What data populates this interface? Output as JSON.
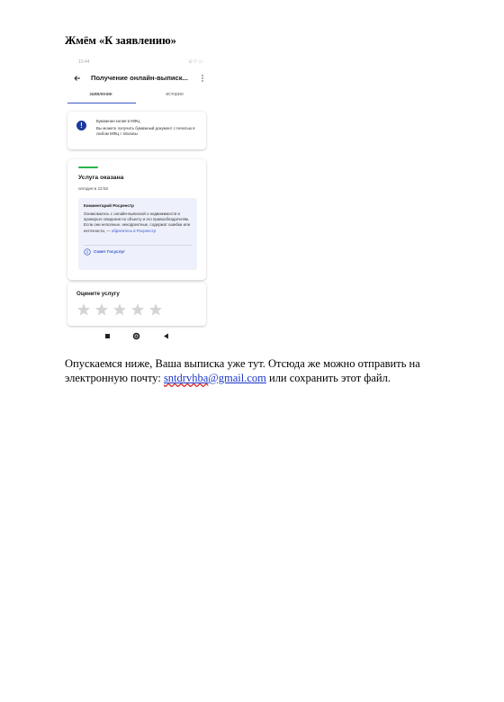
{
  "heading": "Жмём «К заявлению»",
  "phone": {
    "status_time": "10:44",
    "status_icons": "⊙ ▽ ▭",
    "appbar_title": "Получение онлайн-выписк...",
    "tabs": [
      {
        "label": "заявление",
        "active": true
      },
      {
        "label": "история",
        "active": false
      }
    ],
    "info_card": {
      "title": "Бумажная копия в МФЦ",
      "text": "Вы можете получить бумажный документ с печатью в любом МФЦ г. Москвы"
    },
    "service_card": {
      "title": "Услуга оказана",
      "time": "сегодня в 12:52",
      "comment_title": "Комментарий Росреестр",
      "comment_text": "Ознакомьтесь с онлайн-выпиской о недвижимости и проверьте сведения по объекту и его правообладателям. Если они неполные, некорректные, содержат ошибки или неточности, —",
      "comment_link": "обратитесь в Росреестр",
      "advice_label": "Совет Госуслуг"
    },
    "rating_card": {
      "title": "Оцените услугу",
      "stars_total": 5,
      "stars_filled": 0
    },
    "colors": {
      "accent": "#3a57c7",
      "info_icon": "#1d3a9e",
      "success": "#2bb34a",
      "comment_bg": "#eef1fb",
      "star_empty": "#d4d4d4"
    }
  },
  "paragraph": {
    "before": "Опускаемся ниже, Ваша выписка уже тут. Отсюда же можно отправить на электронную почту: ",
    "email_flagged": "sntdrvhba",
    "email_rest": "@gmail.com",
    "after": " или сохранить этот файл."
  },
  "icons": [
    "back-arrow-icon",
    "more-vert-icon",
    "info-icon",
    "advice-info-icon",
    "star-icon",
    "nav-square-icon",
    "nav-home-icon",
    "nav-back-icon"
  ]
}
